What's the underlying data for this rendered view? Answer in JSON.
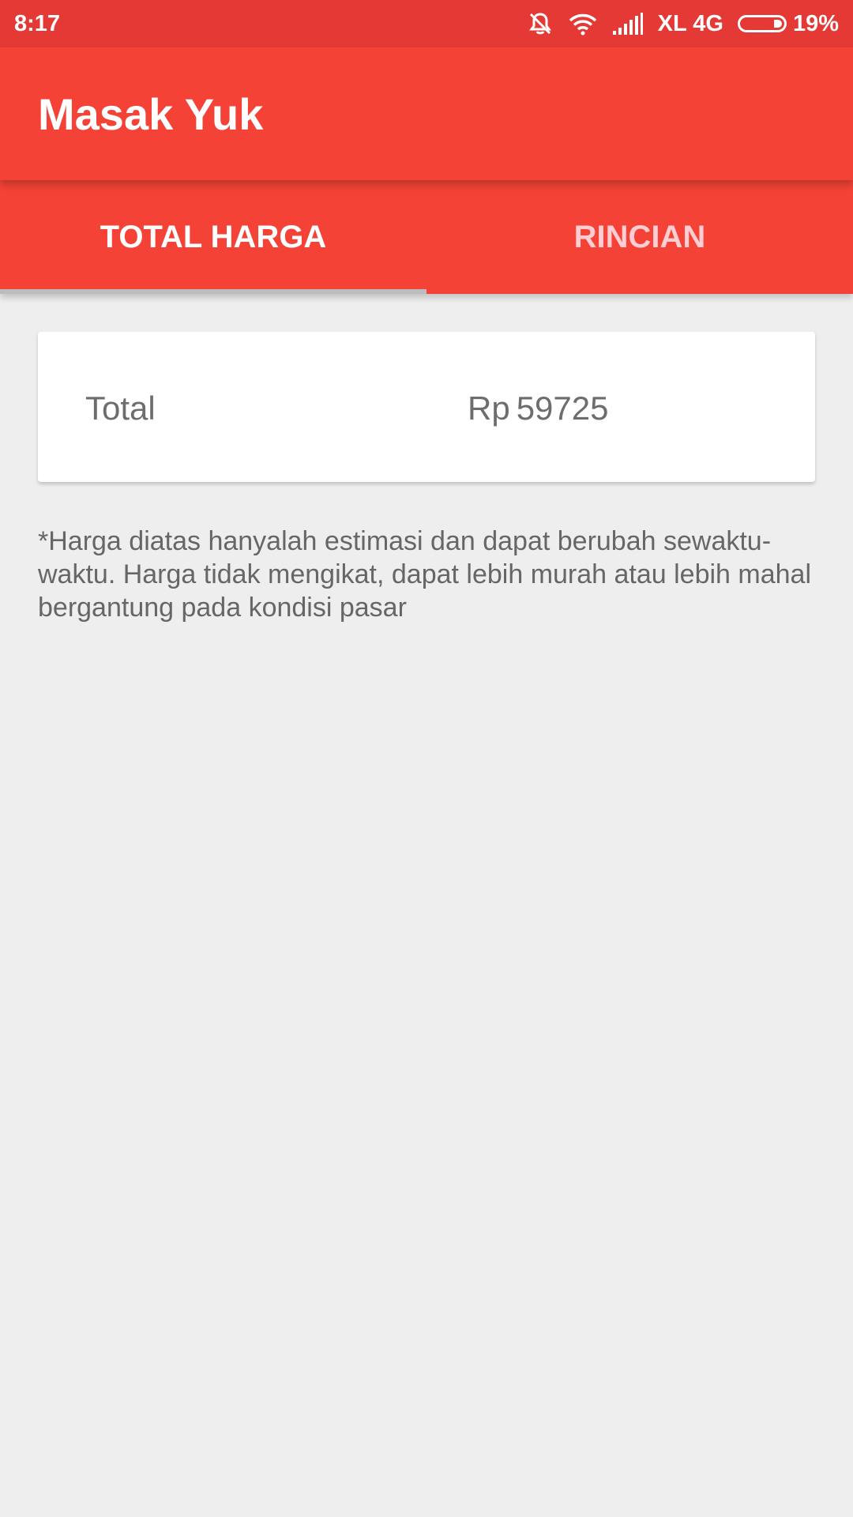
{
  "status_bar": {
    "time": "8:17",
    "network": "XL 4G",
    "battery": "19%",
    "icons": [
      "mute-icon",
      "wifi-icon",
      "signal-icon",
      "battery-icon"
    ]
  },
  "app_bar": {
    "title": "Masak Yuk",
    "color": "#f44336"
  },
  "tabs": [
    {
      "label": "TOTAL HARGA",
      "selected": true
    },
    {
      "label": "RINCIAN",
      "selected": false
    }
  ],
  "summary": {
    "label": "Total",
    "currency": "Rp",
    "amount": "59725"
  },
  "disclaimer": "*Harga diatas hanyalah estimasi dan dapat berubah sewaktu-waktu. Harga tidak mengikat, dapat lebih murah atau lebih mahal bergantung pada kondisi pasar"
}
